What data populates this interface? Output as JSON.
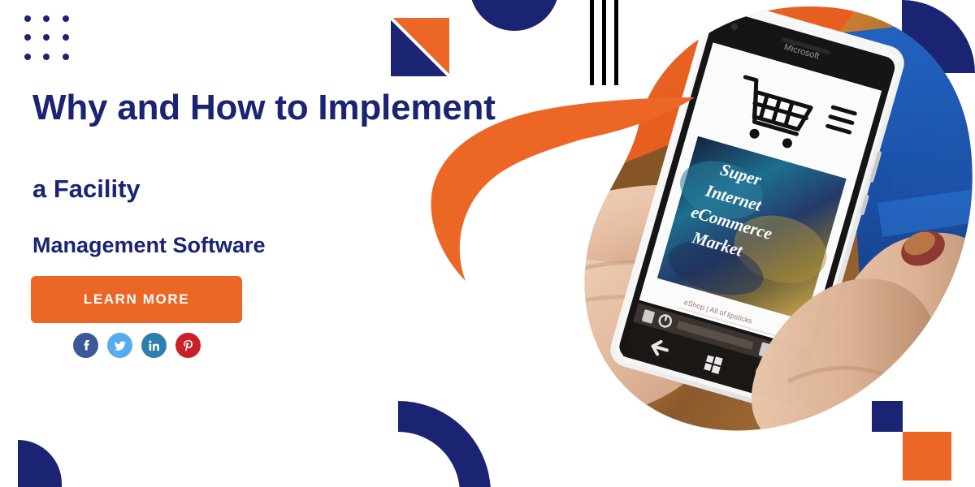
{
  "banner": {
    "background_color": "#ffffff",
    "brand_navy": "#1b2472",
    "brand_orange": "#ec6726"
  },
  "headline": {
    "line1": "Why and How to Implement",
    "line2": "a Facility",
    "line3": "Management Software"
  },
  "cta": {
    "label": "LEARN MORE",
    "background_color": "#ec6726",
    "text_color": "#ffffff"
  },
  "social": {
    "items": [
      {
        "name": "facebook",
        "icon": "facebook-icon",
        "glyph": "f",
        "color": "#3b5998"
      },
      {
        "name": "twitter",
        "icon": "twitter-icon",
        "glyph": "t",
        "color": "#55acee"
      },
      {
        "name": "linkedin",
        "icon": "linkedin-icon",
        "glyph": "in",
        "color": "#2f7fad"
      },
      {
        "name": "pinterest",
        "icon": "pinterest-icon",
        "glyph": "p",
        "color": "#cb2027"
      }
    ]
  },
  "photo": {
    "description": "Hand holding a white Microsoft Lumia smartphone, thumb tapping the screen",
    "phone_brand": "Microsoft",
    "screen": {
      "cart_icon": "shopping-cart-icon",
      "menu_icon": "hamburger-menu-icon",
      "banner_line1": "Super",
      "banner_line2": "Internet",
      "banner_line3": "eCommerce",
      "banner_line4": "Market",
      "footer_text": "eShop  |  All of Lipsticks"
    },
    "nav_bar": {
      "back_icon": "back-arrow-icon",
      "home_icon": "windows-home-icon",
      "search_icon": "search-icon"
    }
  },
  "decor": {
    "dot_grid": {
      "name": "dot-grid",
      "rows": 3,
      "cols": 3,
      "color": "#1b2472"
    },
    "diagonal_square": {
      "name": "diagonal-split-square",
      "top_color": "#ec6726",
      "bottom_color": "#1b2472"
    },
    "half_circle_top": {
      "name": "half-circle",
      "color": "#1b2472"
    },
    "vertical_lines": {
      "name": "triple-vertical-lines",
      "count": 3,
      "color": "#000000"
    },
    "quarter_circle_top_right": {
      "name": "quarter-circle",
      "color": "#1b2472"
    },
    "quarter_circle_bottom_left": {
      "name": "quarter-circle",
      "color": "#1b2472"
    },
    "arc_bottom": {
      "name": "quarter-ring-arc",
      "color": "#1b2472"
    },
    "square_navy": {
      "name": "accent-square",
      "color": "#1b2472"
    },
    "square_orange": {
      "name": "accent-square",
      "color": "#ec6726"
    },
    "orange_blob": {
      "name": "orange-blob",
      "color": "#ec6726"
    }
  }
}
